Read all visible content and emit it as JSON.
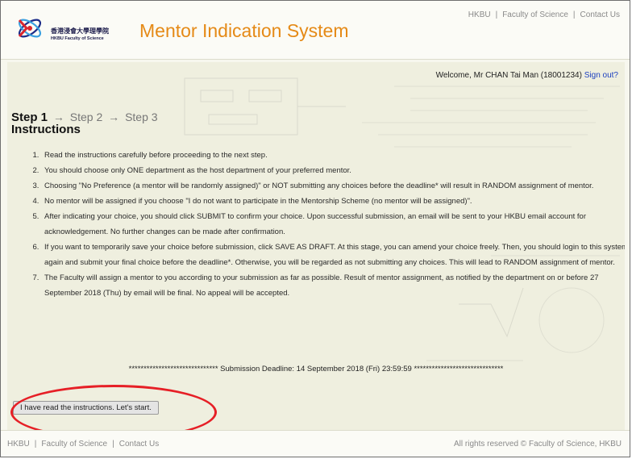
{
  "header": {
    "logo_text_cn": "香港浸會大學理學院",
    "logo_text_en": "HKBU Faculty of Science",
    "app_title": "Mentor Indication System",
    "links": [
      "HKBU",
      "Faculty of Science",
      "Contact Us"
    ],
    "separator": "|"
  },
  "user": {
    "welcome_text": "Welcome, Mr CHAN Tai Man (18001234)",
    "signout_label": "Sign out?"
  },
  "steps": {
    "current": "Step 1",
    "next": [
      "Step 2",
      "Step 3"
    ],
    "arrow": "→"
  },
  "instructions": {
    "heading": "Instructions",
    "items": [
      "Read the instructions carefully before proceeding to the next step.",
      "You should choose only ONE department as the host department of your preferred mentor.",
      "Choosing \"No Preference (a mentor will be randomly assigned)\" or NOT submitting any choices before the deadline* will result in RANDOM assignment of mentor.",
      "No mentor will be assigned if you choose \"I do not want to participate in the Mentorship Scheme (no mentor will be assigned)\".",
      "After indicating your choice, you should click SUBMIT to confirm your choice. Upon successful submission, an email will be sent to your HKBU email account for acknowledgement. No further changes can be made after confirmation.",
      "If you want to temporarily save your choice before submission, click SAVE AS DRAFT. At this stage, you can amend your choice freely. Then, you should login to this system again and submit your final choice before the deadline*. Otherwise, you will be regarded as not submitting any choices. This will lead to RANDOM assignment of mentor.",
      "The Faculty will assign a mentor to you according to your submission as far as possible. Result of mentor assignment, as notified by the department on or before 27 September 2018 (Thu) by email will be final. No appeal will be accepted."
    ]
  },
  "deadline_text": "****************************** Submission Deadline: 14 September 2018 (Fri) 23:59:59 ******************************",
  "start_button_label": "I have read the instructions. Let's start.",
  "footer": {
    "links": [
      "HKBU",
      "Faculty of Science",
      "Contact Us"
    ],
    "separator": "|",
    "copyright": "All rights reserved © Faculty of Science, HKBU"
  },
  "colors": {
    "title_orange": "#e58a17",
    "annotation_red": "#e61f26",
    "link_blue": "#1c3fbe",
    "content_bg": "#efefdf"
  }
}
